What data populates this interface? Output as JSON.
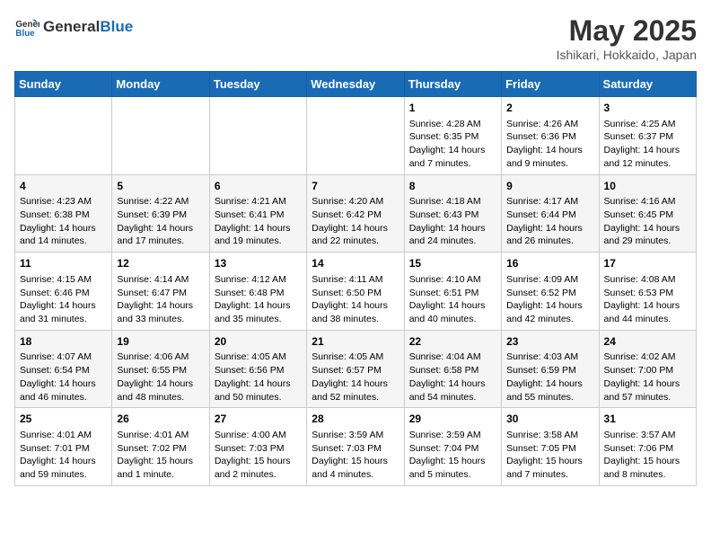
{
  "header": {
    "logo_general": "General",
    "logo_blue": "Blue",
    "month_year": "May 2025",
    "location": "Ishikari, Hokkaido, Japan"
  },
  "days_of_week": [
    "Sunday",
    "Monday",
    "Tuesday",
    "Wednesday",
    "Thursday",
    "Friday",
    "Saturday"
  ],
  "weeks": [
    [
      {
        "day": "",
        "content": ""
      },
      {
        "day": "",
        "content": ""
      },
      {
        "day": "",
        "content": ""
      },
      {
        "day": "",
        "content": ""
      },
      {
        "day": "1",
        "content": "Sunrise: 4:28 AM\nSunset: 6:35 PM\nDaylight: 14 hours\nand 7 minutes."
      },
      {
        "day": "2",
        "content": "Sunrise: 4:26 AM\nSunset: 6:36 PM\nDaylight: 14 hours\nand 9 minutes."
      },
      {
        "day": "3",
        "content": "Sunrise: 4:25 AM\nSunset: 6:37 PM\nDaylight: 14 hours\nand 12 minutes."
      }
    ],
    [
      {
        "day": "4",
        "content": "Sunrise: 4:23 AM\nSunset: 6:38 PM\nDaylight: 14 hours\nand 14 minutes."
      },
      {
        "day": "5",
        "content": "Sunrise: 4:22 AM\nSunset: 6:39 PM\nDaylight: 14 hours\nand 17 minutes."
      },
      {
        "day": "6",
        "content": "Sunrise: 4:21 AM\nSunset: 6:41 PM\nDaylight: 14 hours\nand 19 minutes."
      },
      {
        "day": "7",
        "content": "Sunrise: 4:20 AM\nSunset: 6:42 PM\nDaylight: 14 hours\nand 22 minutes."
      },
      {
        "day": "8",
        "content": "Sunrise: 4:18 AM\nSunset: 6:43 PM\nDaylight: 14 hours\nand 24 minutes."
      },
      {
        "day": "9",
        "content": "Sunrise: 4:17 AM\nSunset: 6:44 PM\nDaylight: 14 hours\nand 26 minutes."
      },
      {
        "day": "10",
        "content": "Sunrise: 4:16 AM\nSunset: 6:45 PM\nDaylight: 14 hours\nand 29 minutes."
      }
    ],
    [
      {
        "day": "11",
        "content": "Sunrise: 4:15 AM\nSunset: 6:46 PM\nDaylight: 14 hours\nand 31 minutes."
      },
      {
        "day": "12",
        "content": "Sunrise: 4:14 AM\nSunset: 6:47 PM\nDaylight: 14 hours\nand 33 minutes."
      },
      {
        "day": "13",
        "content": "Sunrise: 4:12 AM\nSunset: 6:48 PM\nDaylight: 14 hours\nand 35 minutes."
      },
      {
        "day": "14",
        "content": "Sunrise: 4:11 AM\nSunset: 6:50 PM\nDaylight: 14 hours\nand 38 minutes."
      },
      {
        "day": "15",
        "content": "Sunrise: 4:10 AM\nSunset: 6:51 PM\nDaylight: 14 hours\nand 40 minutes."
      },
      {
        "day": "16",
        "content": "Sunrise: 4:09 AM\nSunset: 6:52 PM\nDaylight: 14 hours\nand 42 minutes."
      },
      {
        "day": "17",
        "content": "Sunrise: 4:08 AM\nSunset: 6:53 PM\nDaylight: 14 hours\nand 44 minutes."
      }
    ],
    [
      {
        "day": "18",
        "content": "Sunrise: 4:07 AM\nSunset: 6:54 PM\nDaylight: 14 hours\nand 46 minutes."
      },
      {
        "day": "19",
        "content": "Sunrise: 4:06 AM\nSunset: 6:55 PM\nDaylight: 14 hours\nand 48 minutes."
      },
      {
        "day": "20",
        "content": "Sunrise: 4:05 AM\nSunset: 6:56 PM\nDaylight: 14 hours\nand 50 minutes."
      },
      {
        "day": "21",
        "content": "Sunrise: 4:05 AM\nSunset: 6:57 PM\nDaylight: 14 hours\nand 52 minutes."
      },
      {
        "day": "22",
        "content": "Sunrise: 4:04 AM\nSunset: 6:58 PM\nDaylight: 14 hours\nand 54 minutes."
      },
      {
        "day": "23",
        "content": "Sunrise: 4:03 AM\nSunset: 6:59 PM\nDaylight: 14 hours\nand 55 minutes."
      },
      {
        "day": "24",
        "content": "Sunrise: 4:02 AM\nSunset: 7:00 PM\nDaylight: 14 hours\nand 57 minutes."
      }
    ],
    [
      {
        "day": "25",
        "content": "Sunrise: 4:01 AM\nSunset: 7:01 PM\nDaylight: 14 hours\nand 59 minutes."
      },
      {
        "day": "26",
        "content": "Sunrise: 4:01 AM\nSunset: 7:02 PM\nDaylight: 15 hours\nand 1 minute."
      },
      {
        "day": "27",
        "content": "Sunrise: 4:00 AM\nSunset: 7:03 PM\nDaylight: 15 hours\nand 2 minutes."
      },
      {
        "day": "28",
        "content": "Sunrise: 3:59 AM\nSunset: 7:03 PM\nDaylight: 15 hours\nand 4 minutes."
      },
      {
        "day": "29",
        "content": "Sunrise: 3:59 AM\nSunset: 7:04 PM\nDaylight: 15 hours\nand 5 minutes."
      },
      {
        "day": "30",
        "content": "Sunrise: 3:58 AM\nSunset: 7:05 PM\nDaylight: 15 hours\nand 7 minutes."
      },
      {
        "day": "31",
        "content": "Sunrise: 3:57 AM\nSunset: 7:06 PM\nDaylight: 15 hours\nand 8 minutes."
      }
    ]
  ]
}
